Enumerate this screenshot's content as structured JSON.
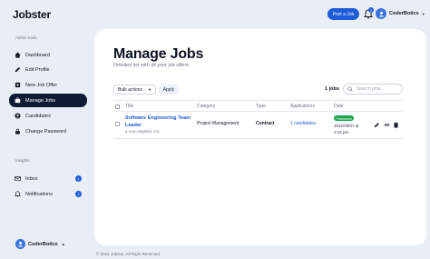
{
  "app": {
    "logo": "Jobster"
  },
  "topbar": {
    "post_job_label": "Post a Job",
    "notification_count": "2",
    "user_name": "CoderBotics",
    "user_initial": "C",
    "icons": {
      "bell": "bell-icon",
      "chevron": "chevron-down-icon"
    }
  },
  "sidebar": {
    "admin_label": "Admin tools",
    "admin_items": [
      {
        "label": "Dashboard",
        "icon": "dashboard-icon"
      },
      {
        "label": "Edit Profile",
        "icon": "edit-profile-icon"
      },
      {
        "label": "New Job Offer",
        "icon": "new-job-icon"
      },
      {
        "label": "Manage Jobs",
        "icon": "briefcase-icon",
        "active": true
      },
      {
        "label": "Candidates",
        "icon": "candidates-icon"
      },
      {
        "label": "Change Password",
        "icon": "lock-icon"
      }
    ],
    "insights_label": "Insights",
    "insight_items": [
      {
        "label": "Inbox",
        "icon": "envelope-icon",
        "badge": "1"
      },
      {
        "label": "Notifications",
        "icon": "bell-icon",
        "badge": "2"
      }
    ],
    "user_name": "CoderBotics",
    "user_initial": "C"
  },
  "main": {
    "title": "Manage Jobs",
    "subtitle": "Detailed list with all your job offers.",
    "bulk_actions_label": "Bulk actions",
    "apply_label": "Apply",
    "count_label": "1 jobs",
    "search_placeholder": "Search jobs...",
    "columns": [
      "Title",
      "Category",
      "Type",
      "Applications",
      "Date"
    ],
    "rows": [
      {
        "title": "Software Engineering Team Leader",
        "location": "Los Angeles, CA",
        "category": "Project Management",
        "type": "Contract",
        "applications": "1 candidates",
        "status": "Published",
        "date": "2022/09/07 at",
        "time": "2:42 pm"
      }
    ]
  },
  "footer": {
    "text": "© 2022 Jobster. All Right Reserved."
  },
  "colors": {
    "accent": "#1e5bd7",
    "active_nav": "#0f1b33",
    "published": "#16a34a",
    "background": "#e9eef6"
  }
}
